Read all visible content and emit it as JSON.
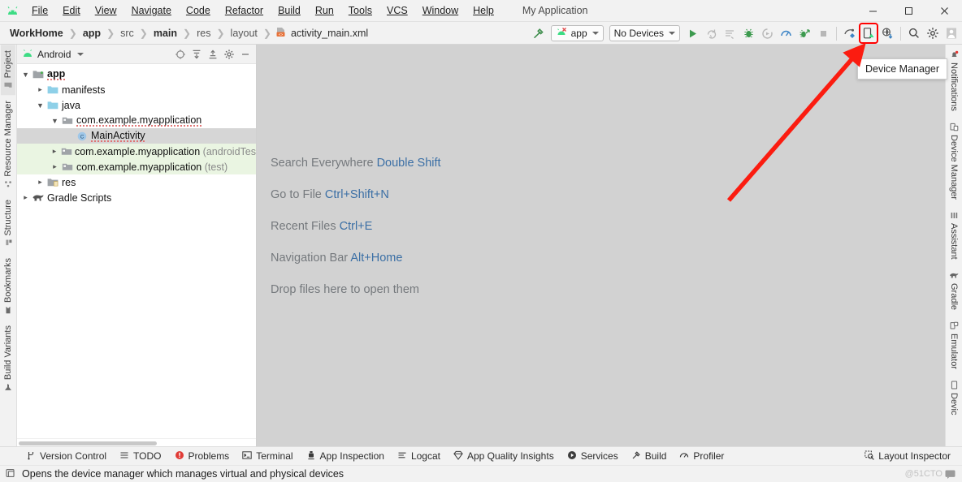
{
  "window": {
    "title": "My Application",
    "app_icon": "android-logo-icon",
    "controls": {
      "minimize": "—",
      "maximize": "□",
      "close": "✕"
    }
  },
  "menubar": [
    {
      "label": "File",
      "mnemonic": "F"
    },
    {
      "label": "Edit",
      "mnemonic": "E"
    },
    {
      "label": "View",
      "mnemonic": "V"
    },
    {
      "label": "Navigate",
      "mnemonic": "N"
    },
    {
      "label": "Code",
      "mnemonic": "C"
    },
    {
      "label": "Refactor",
      "mnemonic": "R"
    },
    {
      "label": "Build",
      "mnemonic": "B"
    },
    {
      "label": "Run",
      "mnemonic": "u"
    },
    {
      "label": "Tools",
      "mnemonic": "T"
    },
    {
      "label": "VCS",
      "mnemonic": "S"
    },
    {
      "label": "Window",
      "mnemonic": "W"
    },
    {
      "label": "Help",
      "mnemonic": "H"
    }
  ],
  "breadcrumb": [
    {
      "label": "WorkHome",
      "bold": true
    },
    {
      "label": "app",
      "bold": true
    },
    {
      "label": "src",
      "bold": false
    },
    {
      "label": "main",
      "bold": true
    },
    {
      "label": "res",
      "bold": false
    },
    {
      "label": "layout",
      "bold": false
    },
    {
      "label": "activity_main.xml",
      "bold": false,
      "icon": "xml-layout-file-icon"
    }
  ],
  "toolbar": {
    "build_icon": "hammer-build-icon",
    "run_config": {
      "label": "app",
      "icon": "android-run-config-icon"
    },
    "device_selector": {
      "label": "No Devices"
    },
    "actions": [
      {
        "name": "run-button",
        "icon": "play-icon",
        "enabled": true
      },
      {
        "name": "rerun-button",
        "icon": "rerun-icon",
        "enabled": false
      },
      {
        "name": "stop-redo-button",
        "icon": "apply-changes-icon",
        "enabled": false
      },
      {
        "name": "debug-button",
        "icon": "bug-icon",
        "enabled": true
      },
      {
        "name": "run-with-coverage-button",
        "icon": "coverage-icon",
        "enabled": false
      },
      {
        "name": "profiler-button",
        "icon": "gauge-profiler-icon",
        "enabled": true
      },
      {
        "name": "attach-debugger-button",
        "icon": "attach-debugger-icon",
        "enabled": true
      },
      {
        "name": "stop-button",
        "icon": "stop-square-icon",
        "enabled": false
      }
    ],
    "right_actions": [
      {
        "name": "sdk-manager-button",
        "icon": "sdk-manager-icon"
      },
      {
        "name": "device-manager-button",
        "icon": "device-manager-icon",
        "highlighted": true
      },
      {
        "name": "avd-download-button",
        "icon": "device-download-icon"
      },
      {
        "name": "search-button",
        "icon": "search-icon"
      },
      {
        "name": "settings-button",
        "icon": "gear-icon"
      },
      {
        "name": "account-button",
        "icon": "account-avatar-icon"
      }
    ]
  },
  "tooltip": {
    "text": "Device Manager"
  },
  "left_rail": [
    {
      "label": "Project",
      "icon": "project-folder-icon",
      "active": true
    },
    {
      "label": "Resource Manager",
      "icon": "resource-manager-icon",
      "active": false
    },
    {
      "label": "Structure",
      "icon": "structure-icon",
      "active": false
    },
    {
      "label": "Bookmarks",
      "icon": "bookmark-icon",
      "active": false
    },
    {
      "label": "Build Variants",
      "icon": "build-variants-icon",
      "active": false
    }
  ],
  "right_rail": [
    {
      "label": "Notifications",
      "icon": "bell-notification-icon"
    },
    {
      "label": "Device Manager",
      "icon": "device-manager-icon"
    },
    {
      "label": "Assistant",
      "icon": "assistant-icon"
    },
    {
      "label": "Gradle",
      "icon": "gradle-elephant-icon"
    },
    {
      "label": "Emulator",
      "icon": "emulator-icon"
    },
    {
      "label": "Devic",
      "icon": "device-icon"
    }
  ],
  "project_panel": {
    "title": "Android",
    "dropdown_icon": "chevron-down-icon",
    "header_buttons": [
      {
        "name": "select-opened-file-button",
        "icon": "crosshair-target-icon"
      },
      {
        "name": "expand-all-button",
        "icon": "expand-all-icon"
      },
      {
        "name": "collapse-all-button",
        "icon": "collapse-all-icon"
      },
      {
        "name": "panel-settings-button",
        "icon": "gear-icon"
      },
      {
        "name": "hide-panel-button",
        "icon": "minus-icon"
      }
    ],
    "tree": [
      {
        "label": "app",
        "suffix": "",
        "indent": 0,
        "expander": "down",
        "icon": "module-folder-icon",
        "bold": true,
        "selected": false,
        "test": false,
        "squiggle": true
      },
      {
        "label": "manifests",
        "suffix": "",
        "indent": 1,
        "expander": "right",
        "icon": "folder-blue-icon",
        "bold": false,
        "selected": false,
        "test": false,
        "squiggle": false
      },
      {
        "label": "java",
        "suffix": "",
        "indent": 1,
        "expander": "down",
        "icon": "folder-blue-icon",
        "bold": false,
        "selected": false,
        "test": false,
        "squiggle": false
      },
      {
        "label": "com.example.myapplication",
        "suffix": "",
        "indent": 2,
        "expander": "down",
        "icon": "package-icon",
        "bold": false,
        "selected": false,
        "test": false,
        "squiggle": true
      },
      {
        "label": "MainActivity",
        "suffix": "",
        "indent": 3,
        "expander": "none",
        "icon": "java-class-icon",
        "bold": false,
        "selected": true,
        "test": false,
        "squiggle": true
      },
      {
        "label": "com.example.myapplication",
        "suffix": " (androidTes",
        "indent": 2,
        "expander": "right",
        "icon": "package-icon",
        "bold": false,
        "selected": false,
        "test": true,
        "squiggle": false
      },
      {
        "label": "com.example.myapplication",
        "suffix": " (test)",
        "indent": 2,
        "expander": "right",
        "icon": "package-icon",
        "bold": false,
        "selected": false,
        "test": true,
        "squiggle": false
      },
      {
        "label": "res",
        "suffix": "",
        "indent": 1,
        "expander": "right",
        "icon": "res-folder-icon",
        "bold": false,
        "selected": false,
        "test": false,
        "squiggle": false
      },
      {
        "label": "Gradle Scripts",
        "suffix": "",
        "indent": 0,
        "expander": "right",
        "icon": "gradle-elephant-icon",
        "bold": false,
        "selected": false,
        "test": false,
        "squiggle": false
      }
    ]
  },
  "editor_welcome": [
    {
      "text": "Search Everywhere ",
      "key": "Double Shift"
    },
    {
      "text": "Go to File ",
      "key": "Ctrl+Shift+N"
    },
    {
      "text": "Recent Files ",
      "key": "Ctrl+E"
    },
    {
      "text": "Navigation Bar ",
      "key": "Alt+Home"
    },
    {
      "text": "Drop files here to open them",
      "key": ""
    }
  ],
  "status_bar": {
    "items": [
      {
        "label": "Version Control",
        "icon": "branch-icon"
      },
      {
        "label": "TODO",
        "icon": "todo-list-icon"
      },
      {
        "label": "Problems",
        "icon": "problems-error-icon"
      },
      {
        "label": "Terminal",
        "icon": "terminal-icon"
      },
      {
        "label": "App Inspection",
        "icon": "app-inspection-icon"
      },
      {
        "label": "Logcat",
        "icon": "logcat-icon"
      },
      {
        "label": "App Quality Insights",
        "icon": "diamond-insights-icon"
      },
      {
        "label": "Services",
        "icon": "services-play-icon"
      },
      {
        "label": "Build",
        "icon": "hammer-build-icon"
      },
      {
        "label": "Profiler",
        "icon": "gauge-profiler-icon"
      }
    ],
    "right_items": [
      {
        "label": "Layout Inspector",
        "icon": "layout-inspector-icon"
      }
    ]
  },
  "hint_bar": {
    "icon": "device-manager-icon",
    "text": "Opens the device manager which manages virtual and physical devices",
    "watermark": "@51CTO"
  },
  "annotation": {
    "arrow_color": "#fb1c10",
    "highlight_color": "#fb0d0d"
  }
}
